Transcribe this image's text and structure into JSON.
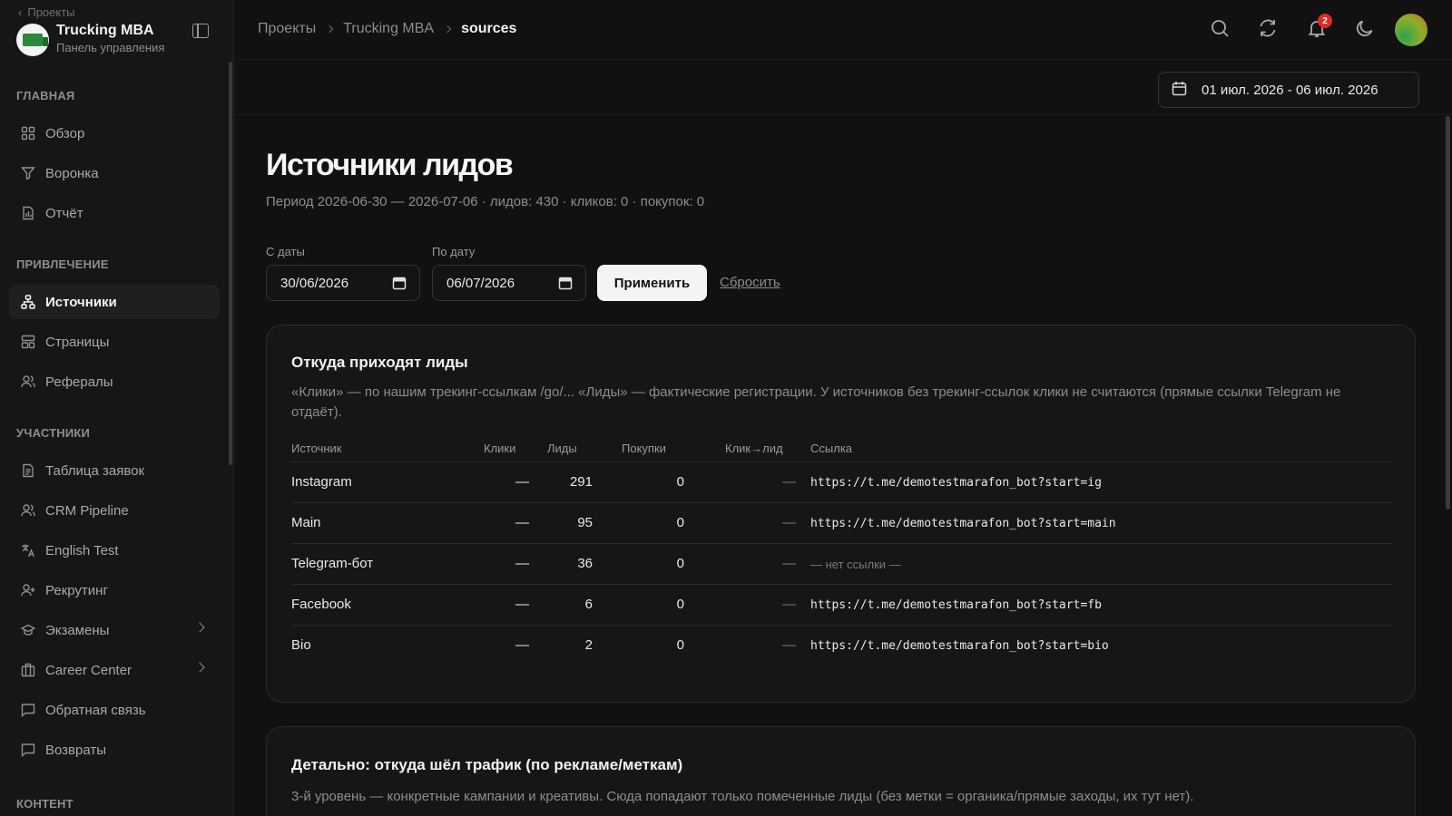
{
  "sidebar": {
    "back_label": "Проекты",
    "project_title": "Trucking MBA",
    "project_subtitle": "Панель управления",
    "sections": {
      "main": "ГЛАВНАЯ",
      "acquisition": "ПРИВЛЕЧЕНИЕ",
      "participants": "УЧАСТНИКИ",
      "content": "КОНТЕНТ"
    },
    "items": {
      "overview": "Обзор",
      "funnel": "Воронка",
      "report": "Отчёт",
      "sources": "Источники",
      "pages": "Страницы",
      "referrals": "Рефералы",
      "applications": "Таблица заявок",
      "crm": "CRM Pipeline",
      "english": "English Test",
      "recruiting": "Рекрутинг",
      "exams": "Экзамены",
      "career": "Career Center",
      "feedback": "Обратная связь",
      "refunds": "Возвраты"
    }
  },
  "topbar": {
    "crumbs": [
      "Проекты",
      "Trucking MBA",
      "sources"
    ],
    "notification_count": "2",
    "date_range": "01 июл. 2026 - 06 июл. 2026"
  },
  "main": {
    "title": "Источники лидов",
    "meta": "Период 2026-06-30 — 2026-07-06 · лидов: 430 · кликов: 0 · покупок: 0",
    "filters": {
      "from_label": "С даты",
      "from_value": "30/06/2026",
      "to_label": "По дату",
      "to_value": "06/07/2026",
      "apply": "Применить",
      "reset": "Сбросить"
    },
    "card1": {
      "title": "Откуда приходят лиды",
      "desc": "«Клики» — по нашим трекинг-ссылкам /go/... «Лиды» — фактические регистрации. У источников без трекинг-ссылок клики не считаются (прямые ссылки Telegram не отдаёт).",
      "headers": [
        "Источник",
        "Клики",
        "Лиды",
        "Покупки",
        "Клик→лид",
        "Ссылка"
      ],
      "rows": [
        {
          "source": "Instagram",
          "clicks": "—",
          "leads": "291",
          "purchases": "0",
          "conv": "—",
          "link": "https://t.me/demotestmarafon_bot?start=ig"
        },
        {
          "source": "Main",
          "clicks": "—",
          "leads": "95",
          "purchases": "0",
          "conv": "—",
          "link": "https://t.me/demotestmarafon_bot?start=main"
        },
        {
          "source": "Telegram-бот",
          "clicks": "—",
          "leads": "36",
          "purchases": "0",
          "conv": "—",
          "link": "— нет ссылки —"
        },
        {
          "source": "Facebook",
          "clicks": "—",
          "leads": "6",
          "purchases": "0",
          "conv": "—",
          "link": "https://t.me/demotestmarafon_bot?start=fb"
        },
        {
          "source": "Bio",
          "clicks": "—",
          "leads": "2",
          "purchases": "0",
          "conv": "—",
          "link": "https://t.me/demotestmarafon_bot?start=bio"
        }
      ]
    },
    "card2": {
      "title": "Детально: откуда шёл трафик (по рекламе/меткам)",
      "desc": "3-й уровень — конкретные кампании и креативы. Сюда попадают только помеченные лиды (без метки = органика/прямые заходы, их тут нет)."
    }
  }
}
